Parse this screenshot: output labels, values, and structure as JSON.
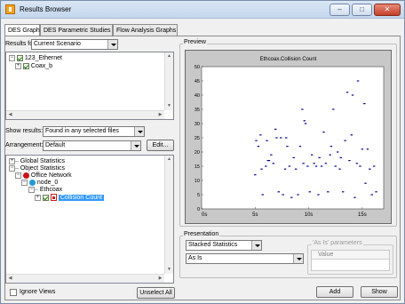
{
  "window": {
    "title": "Results Browser",
    "controls": {
      "minimize": "–",
      "maximize": "□",
      "close": "✕"
    }
  },
  "tabs": [
    {
      "label": "DES Graphs"
    },
    {
      "label": "DES Parametric Studies"
    },
    {
      "label": "Flow Analysis Graphs"
    }
  ],
  "results_for": {
    "label": "Results for:",
    "value": "Current Scenario"
  },
  "scenario_tree": [
    {
      "label": "123_Ethernet"
    },
    {
      "label": "Coax_b"
    }
  ],
  "show_results": {
    "label": "Show results:",
    "value": "Found in any selected files"
  },
  "arrangement": {
    "label": "Arrangement:",
    "value": "Default",
    "edit_button": "Edit..."
  },
  "stats_tree": [
    {
      "label": "Global Statistics"
    },
    {
      "label": "Object Statistics"
    },
    {
      "label": "Office Network"
    },
    {
      "label": "node_0"
    },
    {
      "label": "Ethcoax"
    },
    {
      "label": "Collision Count"
    }
  ],
  "ignore_views": {
    "label": "Ignore Views"
  },
  "unselect_all": "Unselect All",
  "preview": {
    "label": "Preview"
  },
  "chart_data": {
    "type": "scatter",
    "title": "Ethcoax.Collision Count",
    "xlabel": "",
    "ylabel": "",
    "xlim": [
      0,
      17
    ],
    "ylim": [
      0,
      50
    ],
    "x_ticks": [
      "0s",
      "5s",
      "10s",
      "15s"
    ],
    "x_tick_values": [
      0,
      5,
      10,
      15
    ],
    "y_ticks": [
      "0",
      "5",
      "10",
      "15",
      "20",
      "25",
      "30",
      "35",
      "40",
      "45",
      "50"
    ],
    "y_tick_values": [
      0,
      5,
      10,
      15,
      20,
      25,
      30,
      35,
      40,
      45,
      50
    ],
    "grid": false,
    "color": "#00008b",
    "points": [
      [
        5.0,
        12
      ],
      [
        5.1,
        24
      ],
      [
        5.3,
        22
      ],
      [
        5.5,
        26
      ],
      [
        5.6,
        14
      ],
      [
        5.7,
        5
      ],
      [
        6.0,
        15
      ],
      [
        6.1,
        24
      ],
      [
        6.2,
        17
      ],
      [
        6.3,
        17
      ],
      [
        6.5,
        19
      ],
      [
        6.7,
        16
      ],
      [
        6.9,
        28
      ],
      [
        7.0,
        25
      ],
      [
        7.2,
        6
      ],
      [
        7.4,
        25
      ],
      [
        7.6,
        5
      ],
      [
        7.8,
        14
      ],
      [
        7.9,
        25
      ],
      [
        8.0,
        22
      ],
      [
        8.2,
        15
      ],
      [
        8.4,
        4
      ],
      [
        8.6,
        18
      ],
      [
        8.8,
        14
      ],
      [
        9.0,
        5
      ],
      [
        9.2,
        22
      ],
      [
        9.4,
        35
      ],
      [
        9.5,
        16
      ],
      [
        9.6,
        31
      ],
      [
        9.7,
        30
      ],
      [
        9.9,
        15
      ],
      [
        10.1,
        6
      ],
      [
        10.3,
        19
      ],
      [
        10.5,
        16
      ],
      [
        10.7,
        15
      ],
      [
        10.9,
        5
      ],
      [
        11.0,
        18
      ],
      [
        11.2,
        15
      ],
      [
        11.4,
        27
      ],
      [
        11.6,
        16
      ],
      [
        11.8,
        6
      ],
      [
        12.0,
        19
      ],
      [
        12.1,
        22
      ],
      [
        12.3,
        35
      ],
      [
        12.5,
        15
      ],
      [
        12.7,
        20
      ],
      [
        12.9,
        14
      ],
      [
        13.0,
        18
      ],
      [
        13.2,
        6
      ],
      [
        13.4,
        24
      ],
      [
        13.6,
        41
      ],
      [
        13.8,
        17
      ],
      [
        14.0,
        26
      ],
      [
        14.1,
        40
      ],
      [
        14.3,
        4
      ],
      [
        14.5,
        16
      ],
      [
        14.6,
        45
      ],
      [
        14.8,
        15
      ],
      [
        15.0,
        21
      ],
      [
        15.2,
        37
      ],
      [
        15.3,
        9
      ],
      [
        15.5,
        21
      ],
      [
        15.7,
        14
      ],
      [
        15.9,
        5
      ],
      [
        16.1,
        15
      ],
      [
        16.3,
        6
      ]
    ]
  },
  "presentation": {
    "label": "Presentation",
    "mode": "Stacked Statistics",
    "filter": "As Is",
    "params_label": "'As Is' parameters",
    "params_header": "Value"
  },
  "buttons": {
    "add": "Add",
    "show": "Show"
  }
}
